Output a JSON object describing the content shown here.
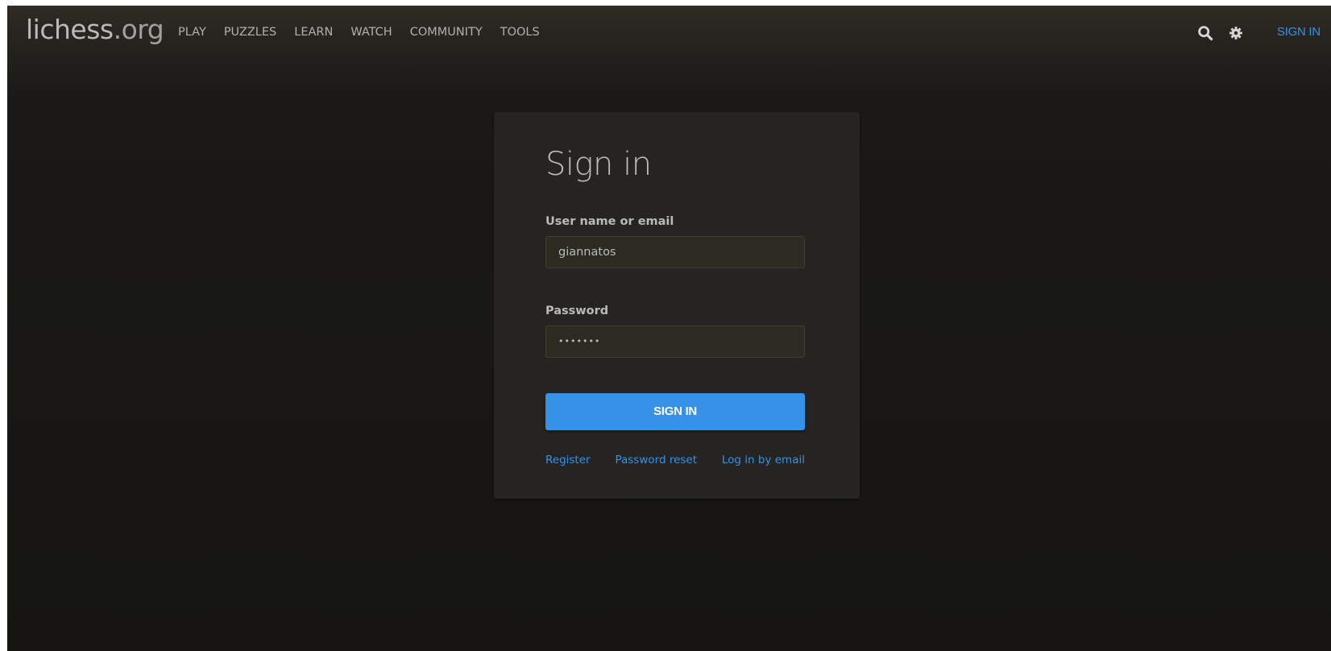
{
  "logo": {
    "main": "lichess",
    "tld": ".org"
  },
  "nav": {
    "items": [
      {
        "label": "PLAY"
      },
      {
        "label": "PUZZLES"
      },
      {
        "label": "LEARN"
      },
      {
        "label": "WATCH"
      },
      {
        "label": "COMMUNITY"
      },
      {
        "label": "TOOLS"
      }
    ]
  },
  "topbar": {
    "icons": [
      "search-icon",
      "gear-icon"
    ],
    "signin_label": "SIGN IN"
  },
  "form": {
    "title": "Sign in",
    "username_label": "User name or email",
    "username_value": "giannatos",
    "password_label": "Password",
    "password_value": "•••••••",
    "submit_label": "SIGN IN",
    "links": {
      "register": "Register",
      "password_reset": "Password reset",
      "email_login": "Log in by email"
    }
  },
  "colors": {
    "accent": "#3692e7",
    "background": "#161512",
    "card": "#262421",
    "text": "#bababa"
  }
}
